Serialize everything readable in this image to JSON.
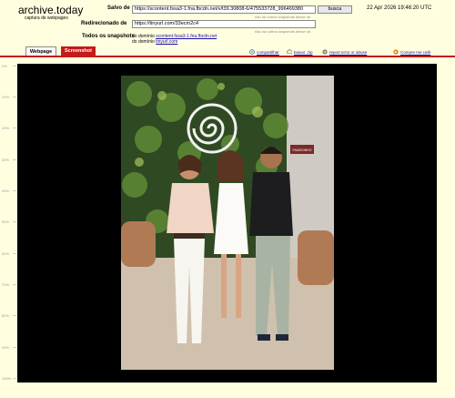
{
  "header": {
    "logo": "archive.today",
    "logo_sub": "captura de webpages",
    "saved_from_label": "Salvo de",
    "saved_from_url": "https://scontent.fssa3-1.fna.fbcdn.net/v/t39.30808-6/475533728_996469380",
    "search_button": "busca",
    "date": "22 Apr 2026 19:46:20 UTC",
    "no_other_note": "não há outros snapshots desse url",
    "redirected_label": "Redirecionado de",
    "redirected_url": "https://tinyurl.com/33ecm2c4",
    "all_snapshots_label": "Todos os snapshots",
    "from_domain_1_prefix": "do domínio",
    "from_domain_1": "scontent.fssa3-1.fna.fbcdn.net",
    "from_domain_2_prefix": "do domínio",
    "from_domain_2": "tinyurl.com"
  },
  "tabs": [
    {
      "label": "Webpage",
      "active": true
    },
    {
      "label": "Screenshot",
      "active": false
    }
  ],
  "toolbar": {
    "share": "compartilhar",
    "download": "baixar .zip",
    "report": "report error or abuse",
    "buy": "Compre me café"
  },
  "ruler": [
    "0%",
    "10%",
    "20%",
    "30%",
    "40%",
    "50%",
    "60%",
    "70%",
    "80%",
    "90%",
    "100%"
  ],
  "colors": {
    "page_bg": "#ffffe0",
    "accent_red": "#c41a1a",
    "viewer_bg": "#000000"
  },
  "photo": {
    "sign_text": "FAMOSINHO"
  }
}
